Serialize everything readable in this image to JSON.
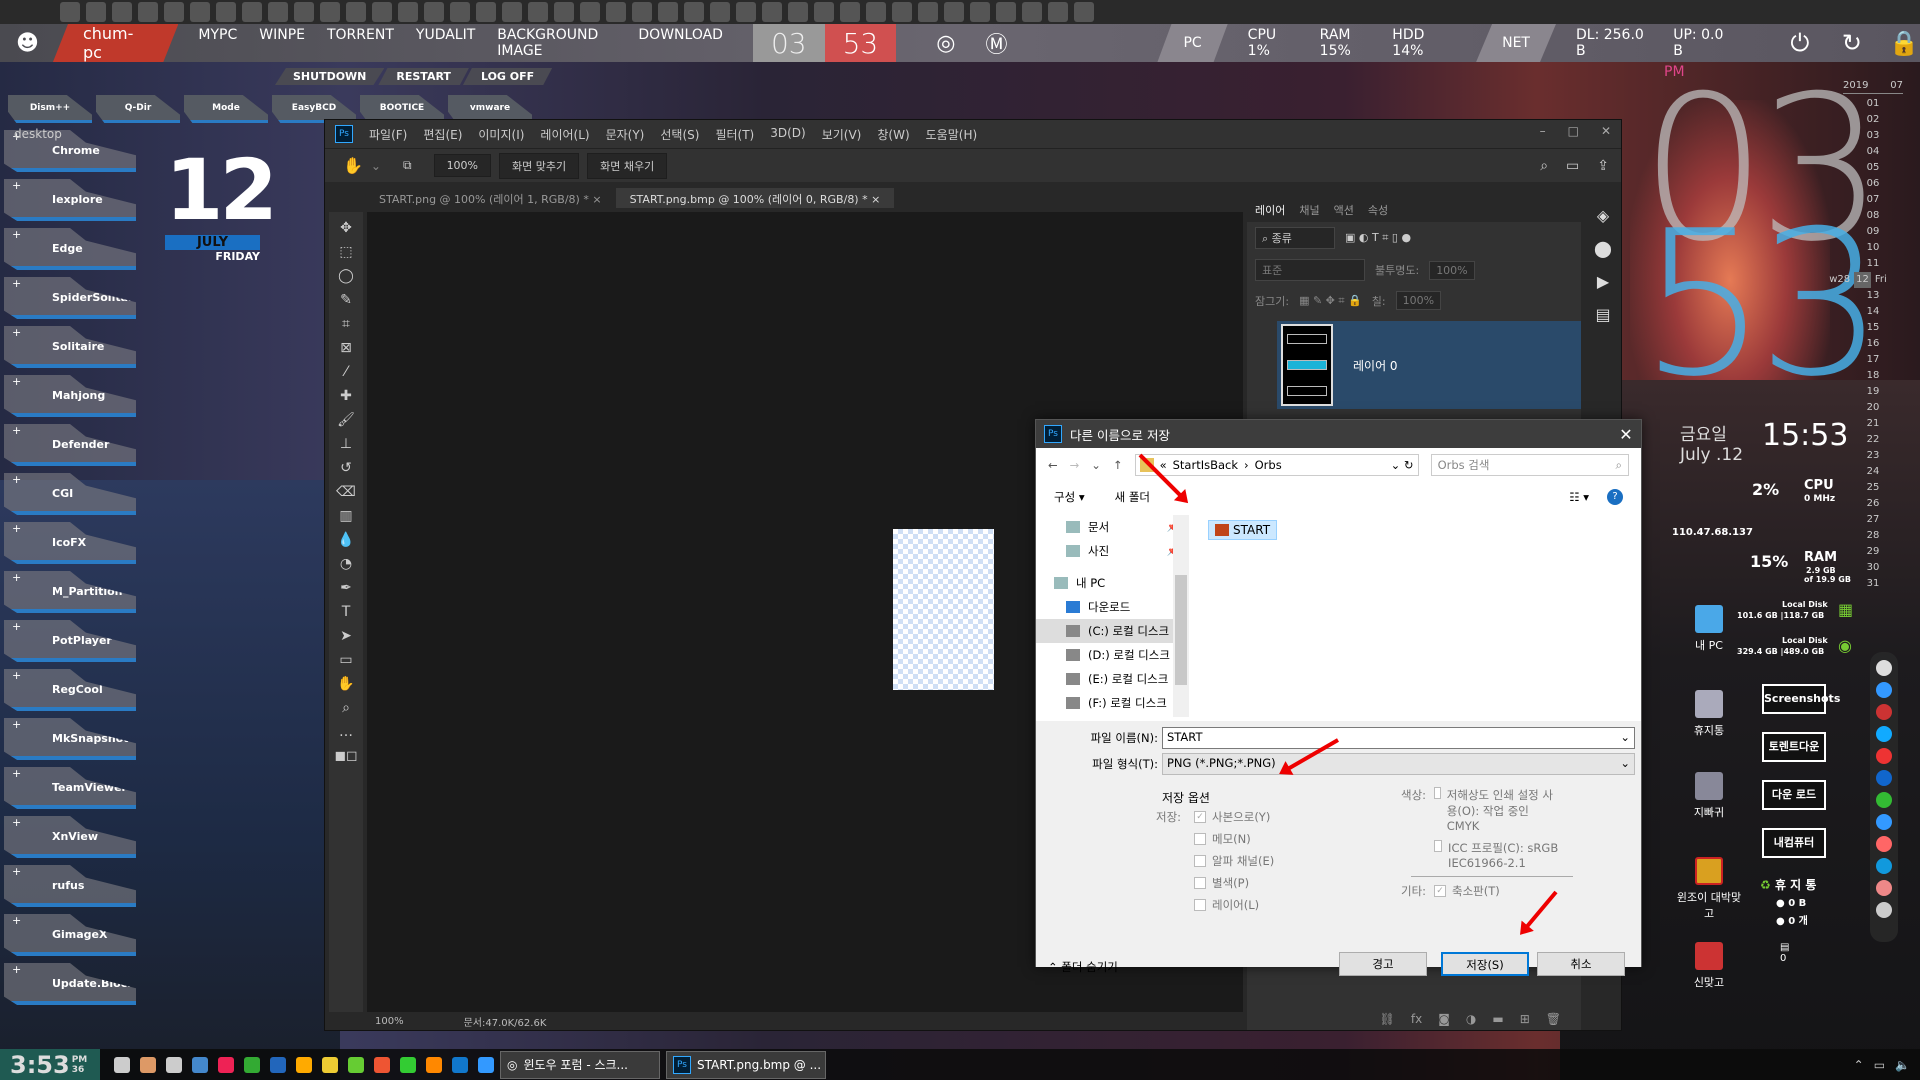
{
  "topbar": {
    "hostname": "chum-pc",
    "nav": [
      "MYPC",
      "WINPE",
      "TORRENT",
      "YUDALIT",
      "BACKGROUND IMAGE",
      "DOWNLOAD"
    ],
    "hour": "03",
    "minute": "53",
    "pc_label": "PC",
    "cpu": "CPU  1%",
    "ram": "RAM  15%",
    "hdd": "HDD  14%",
    "net_label": "NET",
    "dl": "DL: 256.0 B",
    "up": "UP: 0.0 B"
  },
  "system_buttons": [
    "SHUTDOWN",
    "RESTART",
    "LOG OFF"
  ],
  "app_buttons": [
    "Dism++",
    "Q-Dir",
    "Mode",
    "EasyBCD",
    "BOOTICE",
    "vmware"
  ],
  "sidebar": {
    "desktop_label": "desktop",
    "tiles": [
      "Chrome",
      "Iexplore",
      "Edge",
      "SpiderSolitaire",
      "Solitaire",
      "Mahjong",
      "Defender",
      "CGI",
      "IcoFX",
      "M_Partition",
      "PotPlayer",
      "RegCool",
      "MkSnapshot",
      "TeamViewer",
      "XnView",
      "rufus",
      "GimageX",
      "Update.Blocker"
    ]
  },
  "date_widget": {
    "day": "12",
    "month": "JULY",
    "weekday": "FRIDAY"
  },
  "photoshop": {
    "logo": "Ps",
    "menu": [
      "파일(F)",
      "편집(E)",
      "이미지(I)",
      "레이어(L)",
      "문자(Y)",
      "선택(S)",
      "필터(T)",
      "3D(D)",
      "보기(V)",
      "창(W)",
      "도움말(H)"
    ],
    "options": {
      "zoom": "100%",
      "fit": "화면 맞추기",
      "fill": "화면 채우기"
    },
    "tabs": [
      {
        "label": "START.png @ 100% (레이어 1, RGB/8) *",
        "active": false
      },
      {
        "label": "START.png.bmp @ 100% (레이어 0, RGB/8) *",
        "active": true
      }
    ],
    "status": {
      "zoom": "100%",
      "doc": "문서:47.0K/62.6K"
    },
    "layers_panel": {
      "tabs": [
        "레이어",
        "채널",
        "액션",
        "속성"
      ],
      "filter": "종류",
      "blend": "표준",
      "opacity_label": "불투명도:",
      "opacity": "100%",
      "lock_label": "잠그기:",
      "fill_label": "칠:",
      "fill": "100%",
      "layer_name": "레이어 0"
    }
  },
  "save_dialog": {
    "title": "다른 이름으로 저장",
    "path": [
      "StartIsBack",
      "Orbs"
    ],
    "search_placeholder": "Orbs 검색",
    "organize": "구성 ▾",
    "new_folder": "새 폴더",
    "tree": [
      {
        "label": "문서",
        "pinned": true
      },
      {
        "label": "사진",
        "pinned": true
      },
      {
        "label": "내 PC"
      },
      {
        "label": "다운로드"
      },
      {
        "label": "(C:) 로컬 디스크",
        "selected": true
      },
      {
        "label": "(D:) 로컬 디스크"
      },
      {
        "label": "(E:) 로컬 디스크"
      },
      {
        "label": "(F:) 로컬 디스크"
      }
    ],
    "files": [
      "START"
    ],
    "filename_label": "파일 이름(N):",
    "filename": "START",
    "filetype_label": "파일 형식(T):",
    "filetype": "PNG (*.PNG;*.PNG)",
    "save_options_title": "저장 옵션",
    "save_label": "저장:",
    "options": [
      {
        "label": "사본으로(Y)",
        "checked": true
      },
      {
        "label": "메모(N)",
        "checked": false
      },
      {
        "label": "알파 채널(E)",
        "checked": false
      },
      {
        "label": "별색(P)",
        "checked": false
      },
      {
        "label": "레이어(L)",
        "checked": false
      }
    ],
    "color_label": "색상:",
    "color_opts": [
      {
        "label": "저해상도 인쇄 설정 사용(O):  작업 중인 CMYK",
        "checked": false
      },
      {
        "label": "ICC 프로필(C):  sRGB IEC61966-2.1",
        "checked": false
      }
    ],
    "other_label": "기타:",
    "thumbnail": {
      "label": "축소판(T)",
      "checked": true
    },
    "hide_folders": "폴더 숨기기",
    "buttons": {
      "warning": "경고",
      "save": "저장(S)",
      "cancel": "취소"
    }
  },
  "clock_widget": {
    "ampm": "PM",
    "hour": "03",
    "minute": "53",
    "weekday": "금요일",
    "date": "July .12",
    "time": "15:53"
  },
  "calendar": {
    "year": "2019",
    "month": "07",
    "week": "w28",
    "today": "12",
    "today_day": "Fri",
    "days": [
      "01",
      "02",
      "03",
      "04",
      "05",
      "06",
      "07",
      "08",
      "09",
      "10",
      "11",
      "13",
      "14",
      "15",
      "16",
      "17",
      "18",
      "19",
      "20",
      "21",
      "22",
      "23",
      "24",
      "25",
      "26",
      "27",
      "28",
      "29",
      "30",
      "31"
    ]
  },
  "stats": {
    "cpu_pct": "2%",
    "cpu_label": "CPU",
    "cpu_mhz": "0 MHz",
    "ip": "110.47.68.137",
    "ram_pct": "15%",
    "ram_label": "RAM",
    "ram_used": "2.9 GB",
    "ram_total": "of 19.9 GB",
    "disk1_label": "Local Disk",
    "disk1": "101.6 GB  |118.7 GB",
    "disk2_label": "Local Disk",
    "disk2": "329.4 GB  |489.0 GB"
  },
  "desktop_icons": [
    "내 PC",
    "휴지통",
    "지빠귀",
    "윈조이 대박맞고",
    "신맞고"
  ],
  "folders": [
    "Screenshots",
    "토렌트다운",
    "다운 로드",
    "내컴퓨터"
  ],
  "recycle_widget": {
    "title": "휴 지 통",
    "size": "0 B",
    "count": "0 개",
    "files": "0"
  },
  "taskbar": {
    "time": "3:53",
    "ampm": "PM",
    "seconds": "36",
    "tasks": [
      "윈도우 포럼 - 스크...",
      "START.png.bmp @ ..."
    ]
  }
}
